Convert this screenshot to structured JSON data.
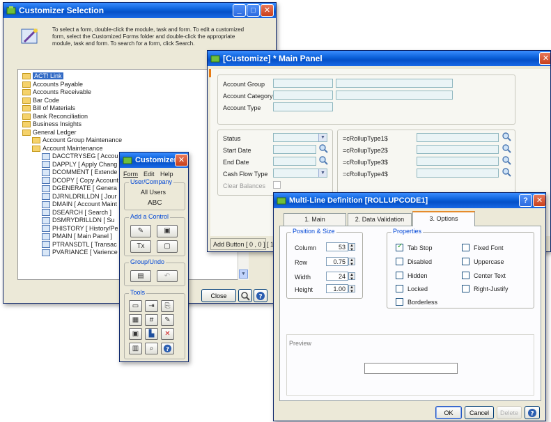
{
  "customizer_selection": {
    "title": "Customizer Selection",
    "instructions_1": "To select a form, double-click the module, task and form. To edit a customized",
    "instructions_2": "form, select the Customized Forms folder and double-click the appropriate",
    "instructions_3": "module, task and form. To search for a form, click Search.",
    "tree": [
      {
        "label": "ACT! Link",
        "kind": "folder",
        "indent": 0,
        "selected": true
      },
      {
        "label": "Accounts Payable",
        "kind": "folder",
        "indent": 0
      },
      {
        "label": "Accounts Receivable",
        "kind": "folder",
        "indent": 0
      },
      {
        "label": "Bar Code",
        "kind": "folder",
        "indent": 0
      },
      {
        "label": "Bill of Materials",
        "kind": "folder",
        "indent": 0
      },
      {
        "label": "Bank Reconciliation",
        "kind": "folder",
        "indent": 0
      },
      {
        "label": "Business Insights",
        "kind": "folder",
        "indent": 0
      },
      {
        "label": "General Ledger",
        "kind": "folder",
        "indent": 0
      },
      {
        "label": "Account Group Maintenance",
        "kind": "folder",
        "indent": 1
      },
      {
        "label": "Account Maintenance",
        "kind": "folder",
        "indent": 1
      },
      {
        "label": "DACCTRYSEG  [ Accou",
        "kind": "form",
        "indent": 2
      },
      {
        "label": "DAPPLY  [ Apply Chang",
        "kind": "form",
        "indent": 2
      },
      {
        "label": "DCOMMENT  [ Extende",
        "kind": "form",
        "indent": 2
      },
      {
        "label": "DCOPY  [ Copy Account",
        "kind": "form",
        "indent": 2
      },
      {
        "label": "DGENERATE  [ Genera",
        "kind": "form",
        "indent": 2
      },
      {
        "label": "DJRNLDRILLDN  [ Jour",
        "kind": "form",
        "indent": 2
      },
      {
        "label": "DMAIN  [ Account Maint",
        "kind": "form",
        "indent": 2
      },
      {
        "label": "DSEARCH  [ Search ]",
        "kind": "form",
        "indent": 2
      },
      {
        "label": "DSMRYDRILLDN  [ Su",
        "kind": "form",
        "indent": 2
      },
      {
        "label": "PHISTORY  [ History/Pe",
        "kind": "form",
        "indent": 2
      },
      {
        "label": "PMAIN  [ Main Panel ]",
        "kind": "form",
        "indent": 2
      },
      {
        "label": "PTRANSDTL  [ Transac",
        "kind": "form",
        "indent": 2
      },
      {
        "label": "PVARIANCE  [ Varience",
        "kind": "form",
        "indent": 2
      }
    ],
    "close_label": "Close"
  },
  "main_panel": {
    "title": "[Customize] * Main Panel",
    "account_group_label": "Account Group",
    "account_category_label": "Account Category",
    "account_type_label": "Account Type",
    "status_label": "Status",
    "start_date_label": "Start Date",
    "end_date_label": "End Date",
    "cash_flow_label": "Cash Flow Type",
    "clear_balances_label": "Clear Balances",
    "rollup1": "=cRollupType1$",
    "rollup2": "=cRollupType2$",
    "rollup3": "=cRollupType3$",
    "rollup4": "=cRollupType4$",
    "status_line": "Add Button  [ 0 , 0 ]  [ 1"
  },
  "customizer_toolbox": {
    "title": "Customizer",
    "menu_form": "Form",
    "menu_edit": "Edit",
    "menu_help": "Help",
    "group_user": "User/Company",
    "user_value": "All Users",
    "company_value": "ABC",
    "group_add": "Add a Control",
    "group_undo": "Group/Undo",
    "group_tools": "Tools"
  },
  "multiline": {
    "title": "Multi-Line Definition  [ROLLUPCODE1]",
    "tab_main": "1. Main",
    "tab_validation": "2. Data Validation",
    "tab_options": "3. Options",
    "pos_group": "Position & Size",
    "column_label": "Column",
    "column_value": "53",
    "row_label": "Row",
    "row_value": "0.75",
    "width_label": "Width",
    "width_value": "24",
    "height_label": "Height",
    "height_value": "1.00",
    "props_group": "Properties",
    "tab_stop": "Tab Stop",
    "disabled": "Disabled",
    "hidden": "Hidden",
    "locked": "Locked",
    "borderless": "Borderless",
    "fixed_font": "Fixed Font",
    "uppercase": "Uppercase",
    "center_text": "Center Text",
    "right_justify": "Right-Justify",
    "preview_label": "Preview",
    "ok_label": "OK",
    "cancel_label": "Cancel",
    "delete_label": "Delete"
  }
}
